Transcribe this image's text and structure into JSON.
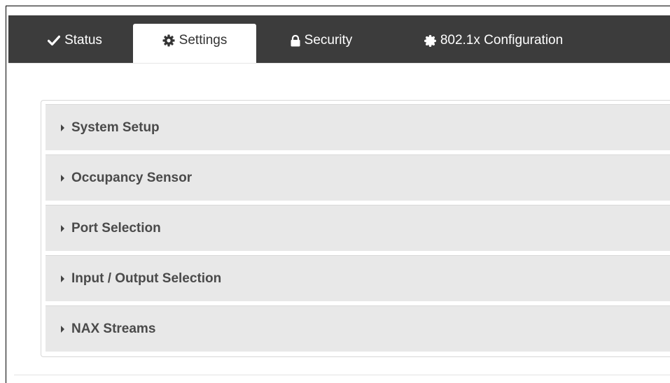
{
  "tabs": [
    {
      "label": "Status",
      "icon": "check-icon",
      "active": false
    },
    {
      "label": "Settings",
      "icon": "gear-icon",
      "active": true
    },
    {
      "label": "Security",
      "icon": "lock-icon",
      "active": false
    },
    {
      "label": "802.1x Configuration",
      "icon": "badge-icon",
      "active": false
    }
  ],
  "panels": [
    {
      "label": "System Setup",
      "expanded": false
    },
    {
      "label": "Occupancy Sensor",
      "expanded": false
    },
    {
      "label": "Port Selection",
      "expanded": false
    },
    {
      "label": "Input / Output Selection",
      "expanded": false
    },
    {
      "label": "NAX Streams",
      "expanded": false
    }
  ],
  "colors": {
    "tabbar_bg": "#3c3c3c",
    "panel_bg": "#e8e8e8",
    "active_tab_bg": "#ffffff"
  }
}
